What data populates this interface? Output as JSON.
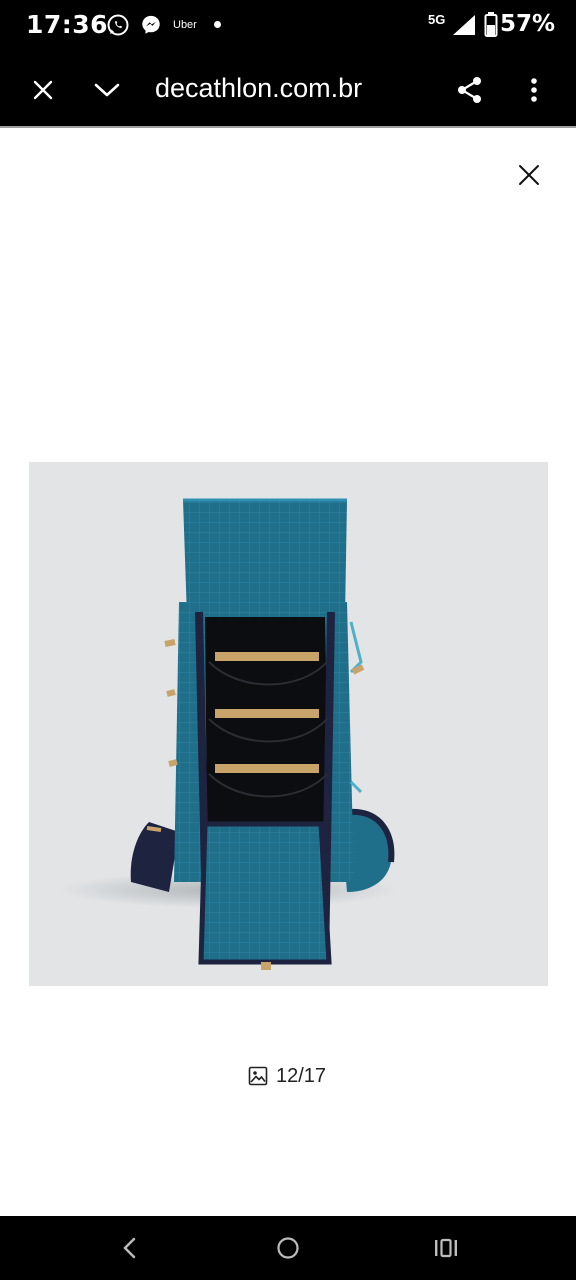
{
  "status_bar": {
    "time": "17:36",
    "icons": [
      "whatsapp-icon",
      "messenger-icon"
    ],
    "uber_label": "Uber",
    "network": "5G",
    "battery": "57%"
  },
  "browser": {
    "url": "decathlon.com.br",
    "icons": [
      "close-icon",
      "chevron-down-icon",
      "share-icon",
      "more-vert-icon"
    ]
  },
  "viewer": {
    "close_icon": "close-icon",
    "image_alt": "Backpack",
    "counter": "12/17",
    "counter_icon": "image-icon"
  },
  "colors": {
    "bar_background": "#000000",
    "image_background": "#e2e4e6",
    "backpack_teal": "#1f6f8b",
    "backpack_navy": "#1e2340"
  },
  "nav": {
    "icons": [
      "back-icon",
      "home-icon",
      "recents-icon"
    ]
  }
}
